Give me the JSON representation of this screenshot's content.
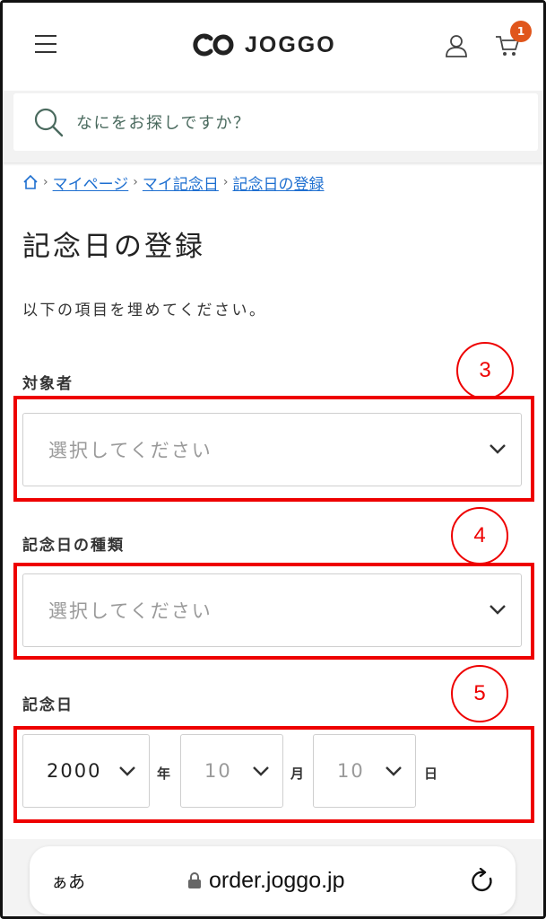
{
  "header": {
    "logo_text": "JOGGO",
    "cart_badge": "1"
  },
  "search": {
    "placeholder": "なにをお探しですか？"
  },
  "breadcrumb": {
    "items": [
      "マイページ",
      "マイ記念日",
      "記念日の登録"
    ]
  },
  "page": {
    "title": "記念日の登録",
    "intro": "以下の項目を埋めてください。"
  },
  "form": {
    "target_label": "対象者",
    "target_value": "選択してください",
    "type_label": "記念日の種類",
    "type_value": "選択してください",
    "date_label": "記念日",
    "year_value": "2000",
    "year_unit": "年",
    "month_value": "10",
    "month_unit": "月",
    "day_value": "10",
    "day_unit": "日"
  },
  "annotations": {
    "marker_3": "3",
    "marker_4": "4",
    "marker_5": "5"
  },
  "browser": {
    "aa_label": "ぁあ",
    "url": "order.joggo.jp"
  },
  "colors": {
    "accent": "#e0561c",
    "link": "#1e6fd0",
    "highlight": "#ee0000"
  }
}
